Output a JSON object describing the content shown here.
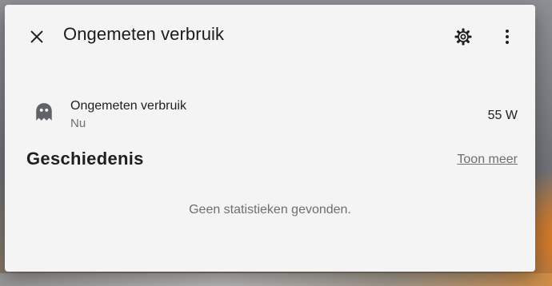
{
  "dialog": {
    "title": "Ongemeten verbruik"
  },
  "header": {
    "close_icon": "close-icon",
    "settings_icon": "gear-icon",
    "menu_icon": "more-vertical-icon"
  },
  "entity": {
    "icon": "ghost-icon",
    "name": "Ongemeten verbruik",
    "secondary": "Nu",
    "value": "55 W"
  },
  "history": {
    "title": "Geschiedenis",
    "show_more_label": "Toon meer",
    "empty_message": "Geen statistieken gevonden."
  },
  "colors": {
    "dialog_background": "#f4f4f4",
    "text_primary": "#1f1f1f",
    "text_secondary": "#707070",
    "icon": "#5f6368"
  }
}
